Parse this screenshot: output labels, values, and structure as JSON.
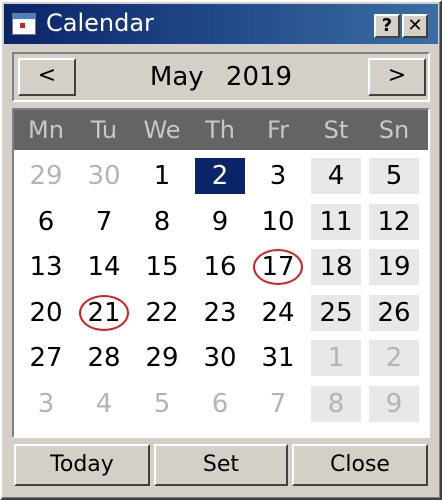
{
  "window": {
    "title": "Calendar",
    "help_label": "?",
    "close_label": "✕"
  },
  "nav": {
    "prev_label": "<",
    "next_label": ">",
    "month_year": "May 2019"
  },
  "weekdays": [
    "Mn",
    "Tu",
    "We",
    "Th",
    "Fr",
    "St",
    "Sn"
  ],
  "weeks": [
    [
      {
        "label": "29",
        "muted": true
      },
      {
        "label": "30",
        "muted": true
      },
      {
        "label": "1"
      },
      {
        "label": "2",
        "selected": true
      },
      {
        "label": "3"
      },
      {
        "label": "4",
        "weekend": true
      },
      {
        "label": "5",
        "weekend": true
      }
    ],
    [
      {
        "label": "6"
      },
      {
        "label": "7"
      },
      {
        "label": "8"
      },
      {
        "label": "9"
      },
      {
        "label": "10"
      },
      {
        "label": "11",
        "weekend": true
      },
      {
        "label": "12",
        "weekend": true
      }
    ],
    [
      {
        "label": "13"
      },
      {
        "label": "14"
      },
      {
        "label": "15"
      },
      {
        "label": "16"
      },
      {
        "label": "17",
        "circled": true
      },
      {
        "label": "18",
        "weekend": true
      },
      {
        "label": "19",
        "weekend": true
      }
    ],
    [
      {
        "label": "20"
      },
      {
        "label": "21",
        "circled": true
      },
      {
        "label": "22"
      },
      {
        "label": "23"
      },
      {
        "label": "24"
      },
      {
        "label": "25",
        "weekend": true
      },
      {
        "label": "26",
        "weekend": true
      }
    ],
    [
      {
        "label": "27"
      },
      {
        "label": "28"
      },
      {
        "label": "29"
      },
      {
        "label": "30"
      },
      {
        "label": "31"
      },
      {
        "label": "1",
        "muted": true,
        "weekend": true
      },
      {
        "label": "2",
        "muted": true,
        "weekend": true
      }
    ],
    [
      {
        "label": "3",
        "muted": true
      },
      {
        "label": "4",
        "muted": true
      },
      {
        "label": "5",
        "muted": true
      },
      {
        "label": "6",
        "muted": true
      },
      {
        "label": "7",
        "muted": true
      },
      {
        "label": "8",
        "muted": true,
        "weekend": true
      },
      {
        "label": "9",
        "muted": true,
        "weekend": true
      }
    ]
  ],
  "buttons": {
    "today": "Today",
    "set": "Set",
    "close": "Close"
  },
  "colors": {
    "selected": "#0a246a",
    "circle": "#d42020",
    "header": "#646464"
  }
}
